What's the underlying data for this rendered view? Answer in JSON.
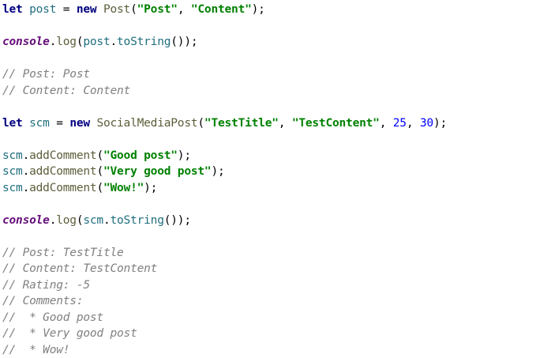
{
  "colors": {
    "background": "#ffffff",
    "keyword": "#000080",
    "variable": "#1f6e7e",
    "plain": "#000000",
    "function": "#5d5d3a",
    "string": "#008000",
    "number": "#0000ff",
    "global": "#660e7a",
    "comment": "#808080"
  },
  "code": {
    "lines": [
      {
        "tokens": [
          {
            "type": "kw",
            "text": "let"
          },
          {
            "type": "plain",
            "text": " "
          },
          {
            "type": "var",
            "text": "post"
          },
          {
            "type": "plain",
            "text": " = "
          },
          {
            "type": "kw",
            "text": "new"
          },
          {
            "type": "plain",
            "text": " "
          },
          {
            "type": "fn",
            "text": "Post"
          },
          {
            "type": "plain",
            "text": "("
          },
          {
            "type": "str",
            "text": "\"Post\""
          },
          {
            "type": "plain",
            "text": ", "
          },
          {
            "type": "str",
            "text": "\"Content\""
          },
          {
            "type": "plain",
            "text": ");"
          }
        ]
      },
      {
        "tokens": []
      },
      {
        "tokens": [
          {
            "type": "global",
            "text": "console"
          },
          {
            "type": "plain",
            "text": "."
          },
          {
            "type": "fn",
            "text": "log"
          },
          {
            "type": "plain",
            "text": "("
          },
          {
            "type": "var",
            "text": "post"
          },
          {
            "type": "plain",
            "text": "."
          },
          {
            "type": "prop",
            "text": "toString"
          },
          {
            "type": "plain",
            "text": "());"
          }
        ]
      },
      {
        "tokens": []
      },
      {
        "tokens": [
          {
            "type": "comment",
            "text": "// Post: Post"
          }
        ]
      },
      {
        "tokens": [
          {
            "type": "comment",
            "text": "// Content: Content"
          }
        ]
      },
      {
        "tokens": []
      },
      {
        "tokens": [
          {
            "type": "kw",
            "text": "let"
          },
          {
            "type": "plain",
            "text": " "
          },
          {
            "type": "var",
            "text": "scm"
          },
          {
            "type": "plain",
            "text": " = "
          },
          {
            "type": "kw",
            "text": "new"
          },
          {
            "type": "plain",
            "text": " "
          },
          {
            "type": "fn",
            "text": "SocialMediaPost"
          },
          {
            "type": "plain",
            "text": "("
          },
          {
            "type": "str",
            "text": "\"TestTitle\""
          },
          {
            "type": "plain",
            "text": ", "
          },
          {
            "type": "str",
            "text": "\"TestContent\""
          },
          {
            "type": "plain",
            "text": ", "
          },
          {
            "type": "num",
            "text": "25"
          },
          {
            "type": "plain",
            "text": ", "
          },
          {
            "type": "num",
            "text": "30"
          },
          {
            "type": "plain",
            "text": ");"
          }
        ]
      },
      {
        "tokens": []
      },
      {
        "tokens": [
          {
            "type": "var",
            "text": "scm"
          },
          {
            "type": "plain",
            "text": "."
          },
          {
            "type": "fn",
            "text": "addComment"
          },
          {
            "type": "plain",
            "text": "("
          },
          {
            "type": "str",
            "text": "\"Good post\""
          },
          {
            "type": "plain",
            "text": ");"
          }
        ]
      },
      {
        "tokens": [
          {
            "type": "var",
            "text": "scm"
          },
          {
            "type": "plain",
            "text": "."
          },
          {
            "type": "fn",
            "text": "addComment"
          },
          {
            "type": "plain",
            "text": "("
          },
          {
            "type": "str",
            "text": "\"Very good post\""
          },
          {
            "type": "plain",
            "text": ");"
          }
        ]
      },
      {
        "tokens": [
          {
            "type": "var",
            "text": "scm"
          },
          {
            "type": "plain",
            "text": "."
          },
          {
            "type": "fn",
            "text": "addComment"
          },
          {
            "type": "plain",
            "text": "("
          },
          {
            "type": "str",
            "text": "\"Wow!\""
          },
          {
            "type": "plain",
            "text": ");"
          }
        ]
      },
      {
        "tokens": []
      },
      {
        "tokens": [
          {
            "type": "global",
            "text": "console"
          },
          {
            "type": "plain",
            "text": "."
          },
          {
            "type": "fn",
            "text": "log"
          },
          {
            "type": "plain",
            "text": "("
          },
          {
            "type": "var",
            "text": "scm"
          },
          {
            "type": "plain",
            "text": "."
          },
          {
            "type": "prop",
            "text": "toString"
          },
          {
            "type": "plain",
            "text": "());"
          }
        ]
      },
      {
        "tokens": []
      },
      {
        "tokens": [
          {
            "type": "comment",
            "text": "// Post: TestTitle"
          }
        ]
      },
      {
        "tokens": [
          {
            "type": "comment",
            "text": "// Content: TestContent"
          }
        ]
      },
      {
        "tokens": [
          {
            "type": "comment",
            "text": "// Rating: -5"
          }
        ]
      },
      {
        "tokens": [
          {
            "type": "comment",
            "text": "// Comments:"
          }
        ]
      },
      {
        "tokens": [
          {
            "type": "comment",
            "text": "//  * Good post"
          }
        ]
      },
      {
        "tokens": [
          {
            "type": "comment",
            "text": "//  * Very good post"
          }
        ]
      },
      {
        "tokens": [
          {
            "type": "comment",
            "text": "//  * Wow!"
          }
        ]
      }
    ]
  }
}
